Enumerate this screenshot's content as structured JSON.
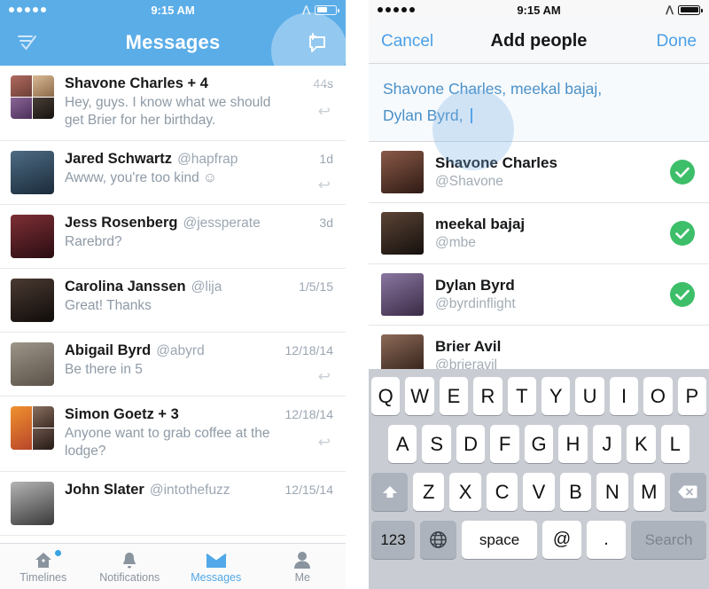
{
  "theme": {
    "header_blue": "#5BADE8",
    "ios_blue": "#4A9FE8",
    "check_green": "#3DBE69",
    "muted_text": "#8E9AA6",
    "keyboard_bg": "#C9CDD3"
  },
  "left_phone": {
    "status_bar": {
      "time": "9:15 AM",
      "carrier_dots": 5,
      "bluetooth": "bluetooth-icon",
      "battery": "battery-icon"
    },
    "nav": {
      "title": "Messages",
      "left_icon": "mark-all-read-icon",
      "right_icon": "new-message-icon"
    },
    "conversations": [
      {
        "name": "Shavone Charles + 4",
        "handle": "",
        "time": "44s",
        "preview": "Hey, guys. I know what we should get Brier for her birthday.",
        "has_reply_arrow": true,
        "avatar_type": "group",
        "avatar_colors": [
          "#8E5C4C",
          "#C8A882",
          "#6E4A7A",
          "#2E2A28"
        ]
      },
      {
        "name": "Jared Schwartz",
        "handle": "@hapfrap",
        "time": "1d",
        "preview": "Awww, you're too kind ☺",
        "has_reply_arrow": true,
        "avatar_type": "single",
        "avatar_colors": [
          "#2C4258"
        ]
      },
      {
        "name": "Jess Rosenberg",
        "handle": "@jessperate",
        "time": "3d",
        "preview": "Rarebrd?",
        "has_reply_arrow": false,
        "avatar_type": "single",
        "avatar_colors": [
          "#4A1C20"
        ]
      },
      {
        "name": "Carolina Janssen",
        "handle": "@lija",
        "time": "1/5/15",
        "preview": "Great! Thanks",
        "has_reply_arrow": false,
        "avatar_type": "single",
        "avatar_colors": [
          "#1E1A18"
        ]
      },
      {
        "name": "Abigail Byrd",
        "handle": "@abyrd",
        "time": "12/18/14",
        "preview": "Be there in 5",
        "has_reply_arrow": true,
        "avatar_type": "single",
        "avatar_colors": [
          "#8A8276"
        ]
      },
      {
        "name": "Simon Goetz + 3",
        "handle": "",
        "time": "12/18/14",
        "preview": "Anyone want to grab coffee at the lodge?",
        "has_reply_arrow": true,
        "avatar_type": "group",
        "avatar_colors": [
          "#6B5648",
          "#E07A2E",
          "#3B2E2A",
          "#C85A32"
        ]
      },
      {
        "name": "John Slater",
        "handle": "@intothefuzz",
        "time": "12/15/14",
        "preview": "",
        "has_reply_arrow": false,
        "avatar_type": "single",
        "avatar_colors": [
          "#6E6E6E"
        ]
      }
    ],
    "tabs": [
      {
        "label": "Timelines",
        "icon": "home-icon",
        "active": false,
        "badge": true
      },
      {
        "label": "Notifications",
        "icon": "bell-icon",
        "active": false,
        "badge": false
      },
      {
        "label": "Messages",
        "icon": "envelope-icon",
        "active": true,
        "badge": false
      },
      {
        "label": "Me",
        "icon": "person-icon",
        "active": false,
        "badge": false
      }
    ]
  },
  "right_phone": {
    "status_bar": {
      "time": "9:15 AM",
      "carrier_dots": 5,
      "bluetooth": "bluetooth-icon",
      "battery": "battery-icon"
    },
    "nav": {
      "cancel_label": "Cancel",
      "title": "Add people",
      "done_label": "Done"
    },
    "recipients_field": {
      "line1": "Shavone Charles, meekal bajaj,",
      "line2": "Dylan Byrd, "
    },
    "people": [
      {
        "name": "Shavone Charles",
        "handle": "@Shavone",
        "selected": true,
        "avatar_colors": [
          "#5A3A30"
        ]
      },
      {
        "name": "meekal bajaj",
        "handle": "@mbe",
        "selected": true,
        "avatar_colors": [
          "#3A2A22"
        ]
      },
      {
        "name": "Dylan Byrd",
        "handle": "@byrdinflight",
        "selected": true,
        "avatar_colors": [
          "#6B5A7A"
        ]
      },
      {
        "name": "Brier Avil",
        "handle": "@brieravil",
        "selected": false,
        "avatar_colors": [
          "#6E5A50"
        ]
      }
    ],
    "keyboard": {
      "row1": [
        "Q",
        "W",
        "E",
        "R",
        "T",
        "Y",
        "U",
        "I",
        "O",
        "P"
      ],
      "row2": [
        "A",
        "S",
        "D",
        "F",
        "G",
        "H",
        "J",
        "K",
        "L"
      ],
      "row3_letters": [
        "Z",
        "X",
        "C",
        "V",
        "B",
        "N",
        "M"
      ],
      "shift_key": "shift-icon",
      "backspace_key": "backspace-icon",
      "numbers_key": "123",
      "globe_key": "globe-icon",
      "space_key": "space",
      "at_key": "@",
      "period_key": ".",
      "search_key": "Search"
    }
  }
}
